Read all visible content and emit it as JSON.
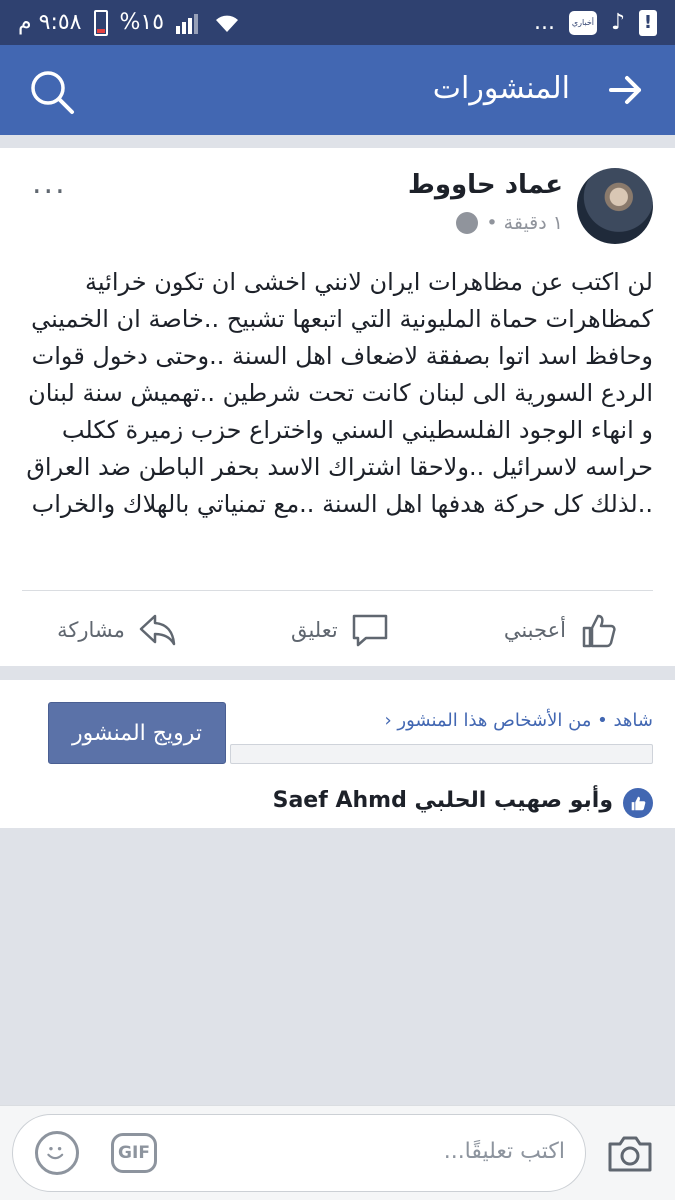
{
  "status_bar": {
    "time": "٩:٥٨ م",
    "battery": "%١٥",
    "app_badge": "أخباري",
    "dots": "...",
    "alert": "!"
  },
  "nav": {
    "title": "المنشورات"
  },
  "post": {
    "author": "عماد حاووط",
    "time": "١ دقيقة •",
    "more": "...",
    "text": "لن اكتب عن مظاهرات ايران لانني اخشى ان تكون خرائية كمظاهرات حماة المليونية التي اتبعها تشبيح ..خاصة ان الخميني وحافظ اسد اتوا بصفقة لاضعاف اهل السنة ..وحتى دخول قوات الردع السورية الى لبنان كانت تحت شرطين ..تهميش سنة لبنان و انهاء الوجود الفلسطيني السني واختراع حزب زميرة ككلب حراسه لاسرائيل ..ولاحقا اشتراك الاسد بحفر الباطن ضد العراق ..لذلك كل حركة هدفها اهل السنة ..مع تمنياتي بالهلاك والخراب",
    "actions": {
      "like": "أعجبني",
      "comment": "تعليق",
      "share": "مشاركة"
    }
  },
  "promo": {
    "insights": "شاهد • من الأشخاص هذا المنشور",
    "boost": "ترويج المنشور",
    "reactors": "وأبو صهيب الحلبي Saef Ahmd"
  },
  "comment_bar": {
    "placeholder": "اكتب تعليقًا...",
    "gif": "GIF"
  }
}
